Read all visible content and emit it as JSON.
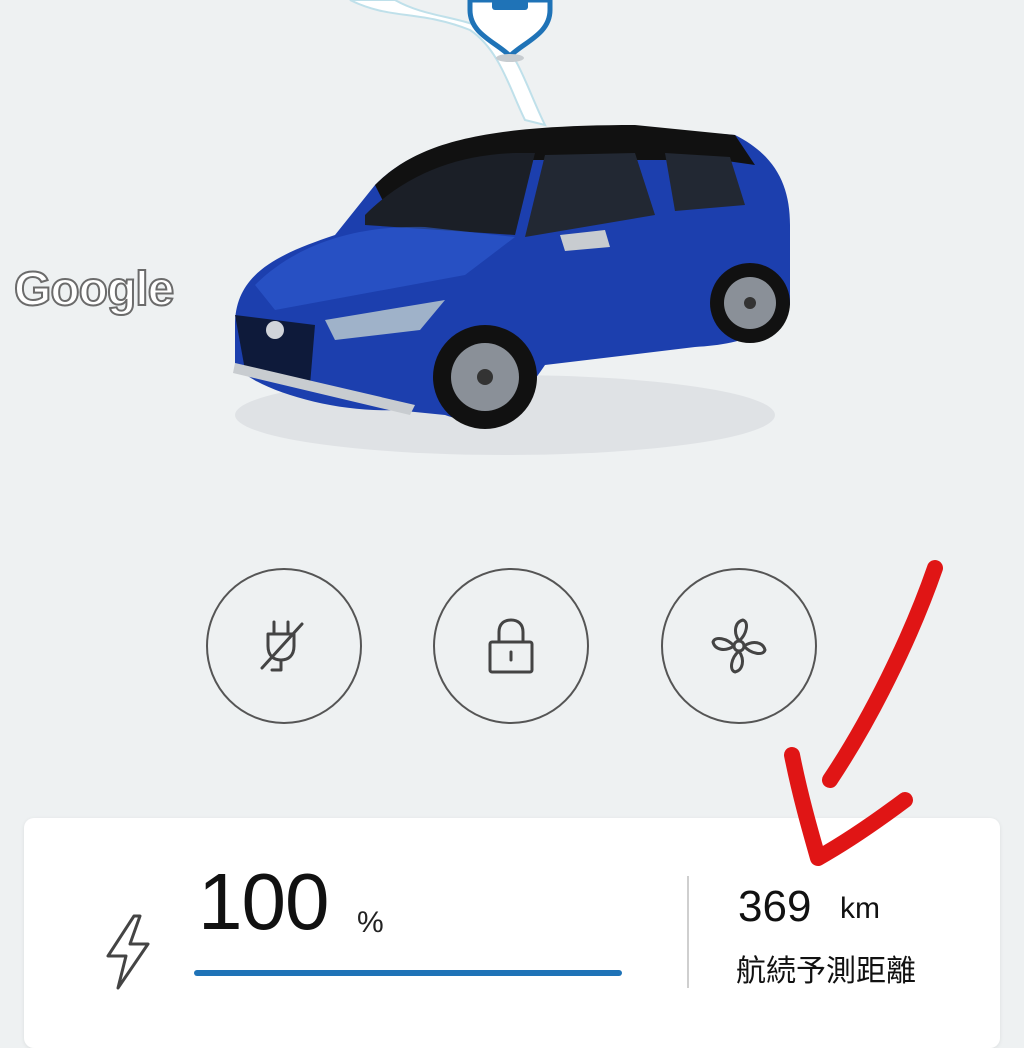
{
  "map": {
    "logo_text": "Google",
    "pin_icon": "car-location-pin-icon",
    "accent_color": "#1f73b7"
  },
  "vehicle": {
    "image_icon": "car-image",
    "body_color": "#1c3fae",
    "roof_color": "#111111"
  },
  "actions": [
    {
      "icon": "charging-off-icon"
    },
    {
      "icon": "lock-icon"
    },
    {
      "icon": "fan-icon"
    }
  ],
  "status": {
    "battery_value": "100",
    "battery_unit": "%",
    "battery_level": 1.0,
    "range_value": "369",
    "range_unit": "km",
    "range_label": "航続予測距離"
  },
  "annotation": {
    "color": "#e01515"
  }
}
